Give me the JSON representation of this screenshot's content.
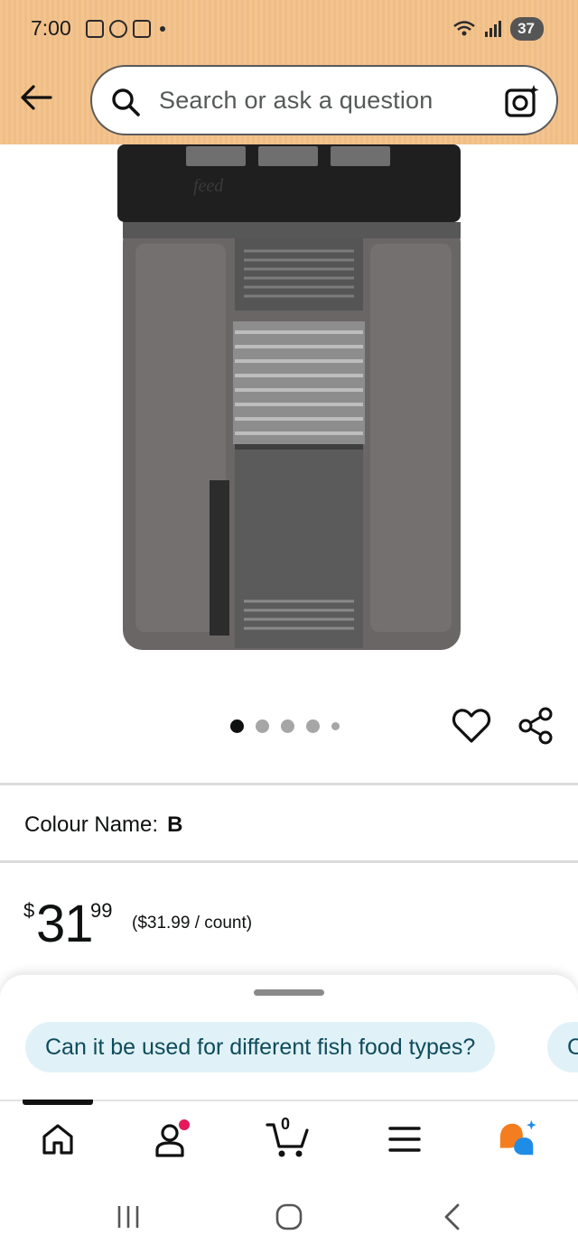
{
  "status_bar": {
    "time": "7:00",
    "battery": "37"
  },
  "search": {
    "placeholder": "Search or ask a question"
  },
  "carousel": {
    "total_images": 5,
    "active_index": 0
  },
  "product": {
    "colour_label": "Colour Name:",
    "colour_value": "B",
    "price_symbol": "$",
    "price_whole": "31",
    "price_fraction": "99",
    "price_per_unit": "($31.99 / count)"
  },
  "suggestions": [
    "Can it be used for different fish food types?",
    "C"
  ],
  "nav": {
    "items": [
      "home-icon",
      "account-icon",
      "cart-icon",
      "menu-icon",
      "rufus-icon"
    ],
    "cart_count": "0",
    "active_index": 0
  },
  "colors": {
    "header_bg": "#f3c48f",
    "chip_bg": "#e0f2f7",
    "chip_text": "#0f4b5c",
    "notification_dot": "#e5195b",
    "rufus_orange": "#f47d20",
    "rufus_blue": "#1f8ce6"
  }
}
